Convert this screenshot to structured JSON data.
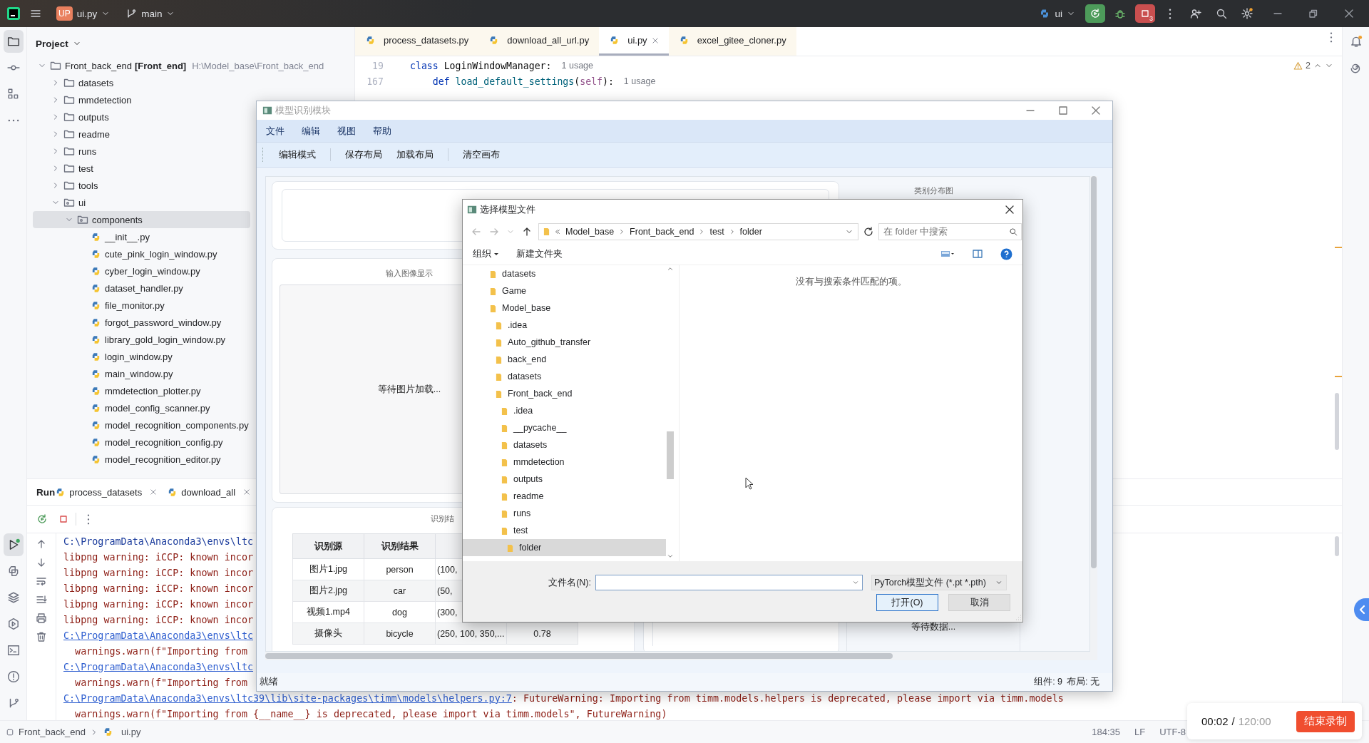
{
  "title_bar": {
    "project_badge": "UP",
    "project": "ui.py",
    "branch": "main",
    "run_config": "ui",
    "run_count": "3"
  },
  "editor_tabs": [
    {
      "label": "process_datasets.py",
      "selected": false
    },
    {
      "label": "download_all_url.py",
      "selected": false
    },
    {
      "label": "ui.py",
      "selected": true
    },
    {
      "label": "excel_gitee_cloner.py",
      "selected": false
    }
  ],
  "inspection": {
    "warnings": "2"
  },
  "code_lines": [
    {
      "number": "19",
      "tokens": [
        {
          "kind": "keyword",
          "text": "class"
        },
        {
          "kind": "plain",
          "text": " LoginWindowManager:"
        }
      ],
      "hint": "1 usage"
    },
    {
      "number": "167",
      "tokens": [
        {
          "kind": "keyword",
          "text": "    def"
        },
        {
          "kind": "function",
          "text": " load_default_settings"
        },
        {
          "kind": "plain",
          "text": "("
        },
        {
          "kind": "self",
          "text": "self"
        },
        {
          "kind": "plain",
          "text": "):"
        }
      ],
      "hint": "1 usage"
    }
  ],
  "project": {
    "title": "Project",
    "tree": [
      {
        "name": "Front_back_end",
        "module": "[Front_end]",
        "path": "H:\\Model_base\\Front_back_end",
        "kind": "folder",
        "expanded": true,
        "selected": false,
        "children": [
          {
            "name": "datasets",
            "kind": "folder",
            "expanded": false,
            "selected": false
          },
          {
            "name": "mmdetection",
            "kind": "folder",
            "expanded": false,
            "selected": false
          },
          {
            "name": "outputs",
            "kind": "folder",
            "expanded": false,
            "selected": false
          },
          {
            "name": "readme",
            "kind": "folder",
            "expanded": false,
            "selected": false
          },
          {
            "name": "runs",
            "kind": "folder",
            "expanded": false,
            "selected": false
          },
          {
            "name": "test",
            "kind": "folder",
            "expanded": false,
            "selected": false
          },
          {
            "name": "tools",
            "kind": "folder",
            "expanded": false,
            "selected": false
          },
          {
            "name": "ui",
            "kind": "package",
            "expanded": true,
            "selected": false,
            "children": [
              {
                "name": "components",
                "kind": "package",
                "expanded": true,
                "selected": true,
                "children": [
                  {
                    "name": "__init__.py",
                    "kind": "file",
                    "selected": false
                  },
                  {
                    "name": "cute_pink_login_window.py",
                    "kind": "file",
                    "selected": false
                  },
                  {
                    "name": "cyber_login_window.py",
                    "kind": "file",
                    "selected": false
                  },
                  {
                    "name": "dataset_handler.py",
                    "kind": "file",
                    "selected": false
                  },
                  {
                    "name": "file_monitor.py",
                    "kind": "file",
                    "selected": false
                  },
                  {
                    "name": "forgot_password_window.py",
                    "kind": "file",
                    "selected": false
                  },
                  {
                    "name": "library_gold_login_window.py",
                    "kind": "file",
                    "selected": false
                  },
                  {
                    "name": "login_window.py",
                    "kind": "file",
                    "selected": false
                  },
                  {
                    "name": "main_window.py",
                    "kind": "file",
                    "selected": false
                  },
                  {
                    "name": "mmdetection_plotter.py",
                    "kind": "file",
                    "selected": false
                  },
                  {
                    "name": "model_config_scanner.py",
                    "kind": "file",
                    "selected": false
                  },
                  {
                    "name": "model_recognition_components.py",
                    "kind": "file",
                    "selected": false
                  },
                  {
                    "name": "model_recognition_config.py",
                    "kind": "file",
                    "selected": false
                  },
                  {
                    "name": "model_recognition_editor.py",
                    "kind": "file",
                    "selected": false
                  }
                ]
              }
            ]
          }
        ]
      }
    ]
  },
  "run": {
    "title": "Run",
    "tabs": [
      {
        "label": "process_datasets"
      },
      {
        "label": "download_all"
      }
    ],
    "console": [
      {
        "segments": [
          {
            "kind": "command",
            "text": "C:\\ProgramData\\Anaconda3\\envs\\ltc"
          }
        ]
      },
      {
        "segments": [
          {
            "kind": "error",
            "text": "libpng warning: iCCP: known incor"
          }
        ]
      },
      {
        "segments": [
          {
            "kind": "error",
            "text": "libpng warning: iCCP: known incor"
          }
        ]
      },
      {
        "segments": [
          {
            "kind": "error",
            "text": "libpng warning: iCCP: known incor"
          }
        ]
      },
      {
        "segments": [
          {
            "kind": "error",
            "text": "libpng warning: iCCP: known incor"
          }
        ]
      },
      {
        "segments": [
          {
            "kind": "error",
            "text": "libpng warning: iCCP: known incor"
          }
        ]
      },
      {
        "segments": [
          {
            "kind": "link",
            "text": "C:\\ProgramData\\Anaconda3\\envs\\ltc"
          }
        ]
      },
      {
        "segments": [
          {
            "kind": "error",
            "text": "  warnings.warn(f\"Importing from"
          }
        ]
      },
      {
        "segments": [
          {
            "kind": "link",
            "text": "C:\\ProgramData\\Anaconda3\\envs\\ltc"
          }
        ]
      },
      {
        "segments": [
          {
            "kind": "error",
            "text": "  warnings.warn(f\"Importing from"
          }
        ]
      },
      {
        "segments": [
          {
            "kind": "link",
            "text": "C:\\ProgramData\\Anaconda3\\envs\\ltc39\\lib\\site-packages\\timm\\models\\helpers.py:7"
          },
          {
            "kind": "error",
            "text": ": FutureWarning: Importing from timm.models.helpers is deprecated, please import via timm.models"
          }
        ]
      },
      {
        "segments": [
          {
            "kind": "error",
            "text": "  warnings.warn(f\"Importing from {__name__} is deprecated, please import via timm.models\", FutureWarning)"
          }
        ]
      }
    ]
  },
  "status_bar": {
    "breadcrumbs": [
      "Front_back_end",
      "ui.py"
    ],
    "position": "184:35",
    "line_ending": "LF",
    "encoding": "UTF-8"
  },
  "recording": {
    "elapsed": "00:02",
    "separator": "/",
    "limit": "120:00",
    "stop_button": "结束录制"
  },
  "app_window": {
    "title": "模型识别模块",
    "menu": [
      "文件",
      "编辑",
      "视图",
      "帮助"
    ],
    "toolbar": [
      "编辑模式",
      "保存布局",
      "加载布局",
      "清空画布"
    ],
    "image_panel": {
      "title": "输入图像显示",
      "placeholder_text": "等待图片加载..."
    },
    "results_panel": {
      "title": "识别结",
      "columns": [
        "识别源",
        "识别结果"
      ],
      "rows": [
        {
          "cells": [
            "图片1.jpg",
            "person",
            "(100,"
          ]
        },
        {
          "cells": [
            "图片2.jpg",
            "car",
            "(50,"
          ]
        },
        {
          "cells": [
            "视频1.mp4",
            "dog",
            "(300,"
          ]
        },
        {
          "cells": [
            "摄像头",
            "bicycle",
            "(250, 100, 350,...",
            "0.78"
          ]
        }
      ]
    },
    "chart_panel": {
      "title": "类别分布图",
      "placeholder_text": "等待数据..."
    },
    "status": "就绪",
    "status_info": [
      "组件: 9",
      "布局: 无"
    ]
  },
  "file_dialog": {
    "title": "选择模型文件",
    "back_disabled": true,
    "forward_disabled": true,
    "path": [
      "Model_base",
      "Front_back_end",
      "test",
      "folder"
    ],
    "search": {
      "placeholder": "在 folder 中搜索"
    },
    "toolbar": [
      "组织",
      "新建文件夹"
    ],
    "folders": [
      {
        "name": "datasets",
        "selected": false
      },
      {
        "name": "Game",
        "selected": false
      },
      {
        "name": "Model_base",
        "selected": false,
        "children": [
          {
            "name": ".idea",
            "selected": false
          },
          {
            "name": "Auto_github_transfer",
            "selected": false
          },
          {
            "name": "back_end",
            "selected": false
          },
          {
            "name": "datasets",
            "selected": false
          },
          {
            "name": "Front_back_end",
            "selected": false,
            "children": [
              {
                "name": ".idea",
                "selected": false
              },
              {
                "name": "__pycache__",
                "selected": false
              },
              {
                "name": "datasets",
                "selected": false
              },
              {
                "name": "mmdetection",
                "selected": false
              },
              {
                "name": "outputs",
                "selected": false
              },
              {
                "name": "readme",
                "selected": false
              },
              {
                "name": "runs",
                "selected": false
              },
              {
                "name": "test",
                "selected": false,
                "children": [
                  {
                    "name": "folder",
                    "selected": true
                  }
                ]
              }
            ]
          }
        ]
      }
    ],
    "empty_message": "没有与搜索条件匹配的项。",
    "file_name_label": "文件名(N):",
    "file_type": "PyTorch模型文件 (*.pt *.pth)",
    "buttons": [
      {
        "label": "打开(O)",
        "default": true
      },
      {
        "label": "取消",
        "default": false
      }
    ]
  }
}
